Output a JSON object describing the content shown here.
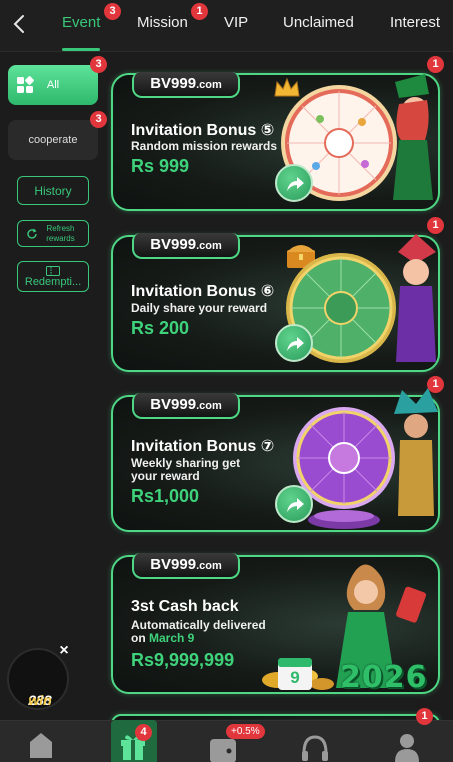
{
  "tabs": [
    {
      "label": "Event",
      "badge": "3",
      "active": true
    },
    {
      "label": "Mission",
      "badge": "1"
    },
    {
      "label": "VIP"
    },
    {
      "label": "Unclaimed"
    },
    {
      "label": "Interest"
    }
  ],
  "sidebar": {
    "all_label": "All",
    "all_badge": "3",
    "cooperate_label": "cooperate",
    "cooperate_badge": "3",
    "history_label": "History",
    "refresh_label": "Refresh rewards",
    "redemption_label": "Redempti..."
  },
  "cards": [
    {
      "brand": "BV999",
      "brand_suffix": ".com",
      "title": "Invitation Bonus",
      "num": "⑤",
      "sub": "Random mission rewards",
      "amount": "Rs 999",
      "badge": "1"
    },
    {
      "brand": "BV999",
      "brand_suffix": ".com",
      "title": "Invitation Bonus",
      "num": "⑥",
      "sub": "Daily share your reward",
      "amount": "Rs 200",
      "badge": "1"
    },
    {
      "brand": "BV999",
      "brand_suffix": ".com",
      "title": "Invitation Bonus",
      "num": "⑦",
      "sub": "Weekly sharing get your reward",
      "amount": "Rs1,000",
      "badge": "1"
    },
    {
      "brand": "BV999",
      "brand_suffix": ".com",
      "title": "3st Cash back",
      "sub_line1": "Automatically delivered",
      "sub_on": "on ",
      "sub_date": "March 9",
      "amount": "Rs9,999,999",
      "year": "2026",
      "calendar": "9"
    }
  ],
  "float": {
    "brand_main": "288",
    "brand_accent": "win",
    "close": "×"
  },
  "bottom_nav": {
    "gift_badge": "4",
    "wallet_pill": "+0.5%",
    "more_badge": "1"
  },
  "colors": {
    "accent": "#39c77a",
    "badge": "#e0363c",
    "gold": "#f2c744"
  }
}
